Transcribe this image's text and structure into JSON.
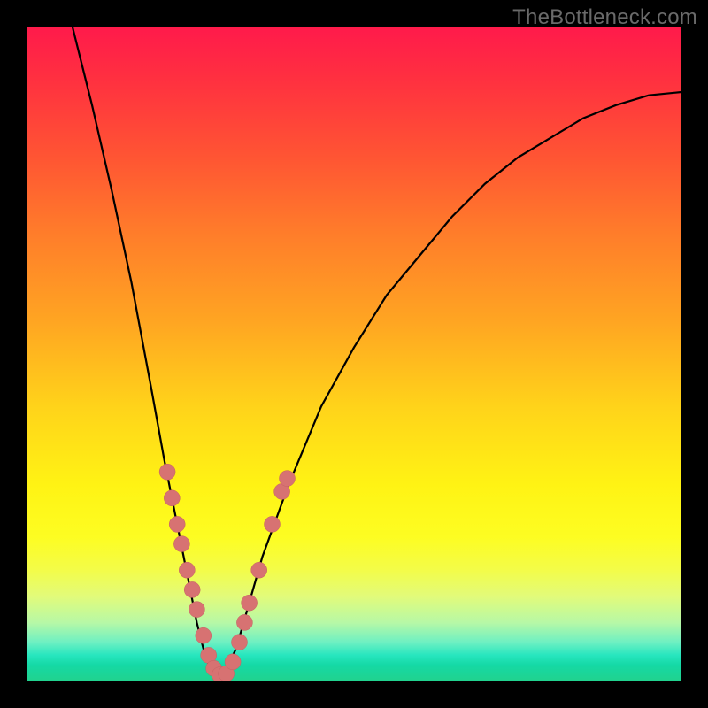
{
  "watermark": "TheBottleneck.com",
  "colors": {
    "background": "#000000",
    "curve": "#000000",
    "marker_fill": "#d77272",
    "marker_stroke": "#c46161"
  },
  "chart_data": {
    "type": "line",
    "title": "",
    "xlabel": "",
    "ylabel": "",
    "xlim": [
      0,
      100
    ],
    "ylim": [
      0,
      100
    ],
    "grid": false,
    "series": [
      {
        "name": "bottleneck-curve",
        "x": [
          7,
          10,
          13,
          16,
          19,
          21,
          23,
          24,
          25,
          26,
          27,
          28,
          29,
          30,
          32,
          34,
          36,
          40,
          45,
          50,
          55,
          60,
          65,
          70,
          75,
          80,
          85,
          90,
          95,
          100
        ],
        "values": [
          100,
          88,
          75,
          61,
          45,
          34,
          24,
          19,
          14,
          9,
          5,
          2,
          0,
          1,
          5,
          12,
          19,
          30,
          42,
          51,
          59,
          65,
          71,
          76,
          80,
          83,
          86,
          88,
          89.5,
          90
        ]
      }
    ],
    "markers": [
      {
        "x": 21.5,
        "y": 32
      },
      {
        "x": 22.2,
        "y": 28
      },
      {
        "x": 23.0,
        "y": 24
      },
      {
        "x": 23.7,
        "y": 21
      },
      {
        "x": 24.5,
        "y": 17
      },
      {
        "x": 25.3,
        "y": 14
      },
      {
        "x": 26.0,
        "y": 11
      },
      {
        "x": 27.0,
        "y": 7
      },
      {
        "x": 27.8,
        "y": 4
      },
      {
        "x": 28.6,
        "y": 2
      },
      {
        "x": 29.5,
        "y": 1
      },
      {
        "x": 30.5,
        "y": 1.2
      },
      {
        "x": 31.5,
        "y": 3
      },
      {
        "x": 32.5,
        "y": 6
      },
      {
        "x": 33.3,
        "y": 9
      },
      {
        "x": 34.0,
        "y": 12
      },
      {
        "x": 35.5,
        "y": 17
      },
      {
        "x": 37.5,
        "y": 24
      },
      {
        "x": 39.0,
        "y": 29
      },
      {
        "x": 39.8,
        "y": 31
      }
    ],
    "annotations": []
  }
}
